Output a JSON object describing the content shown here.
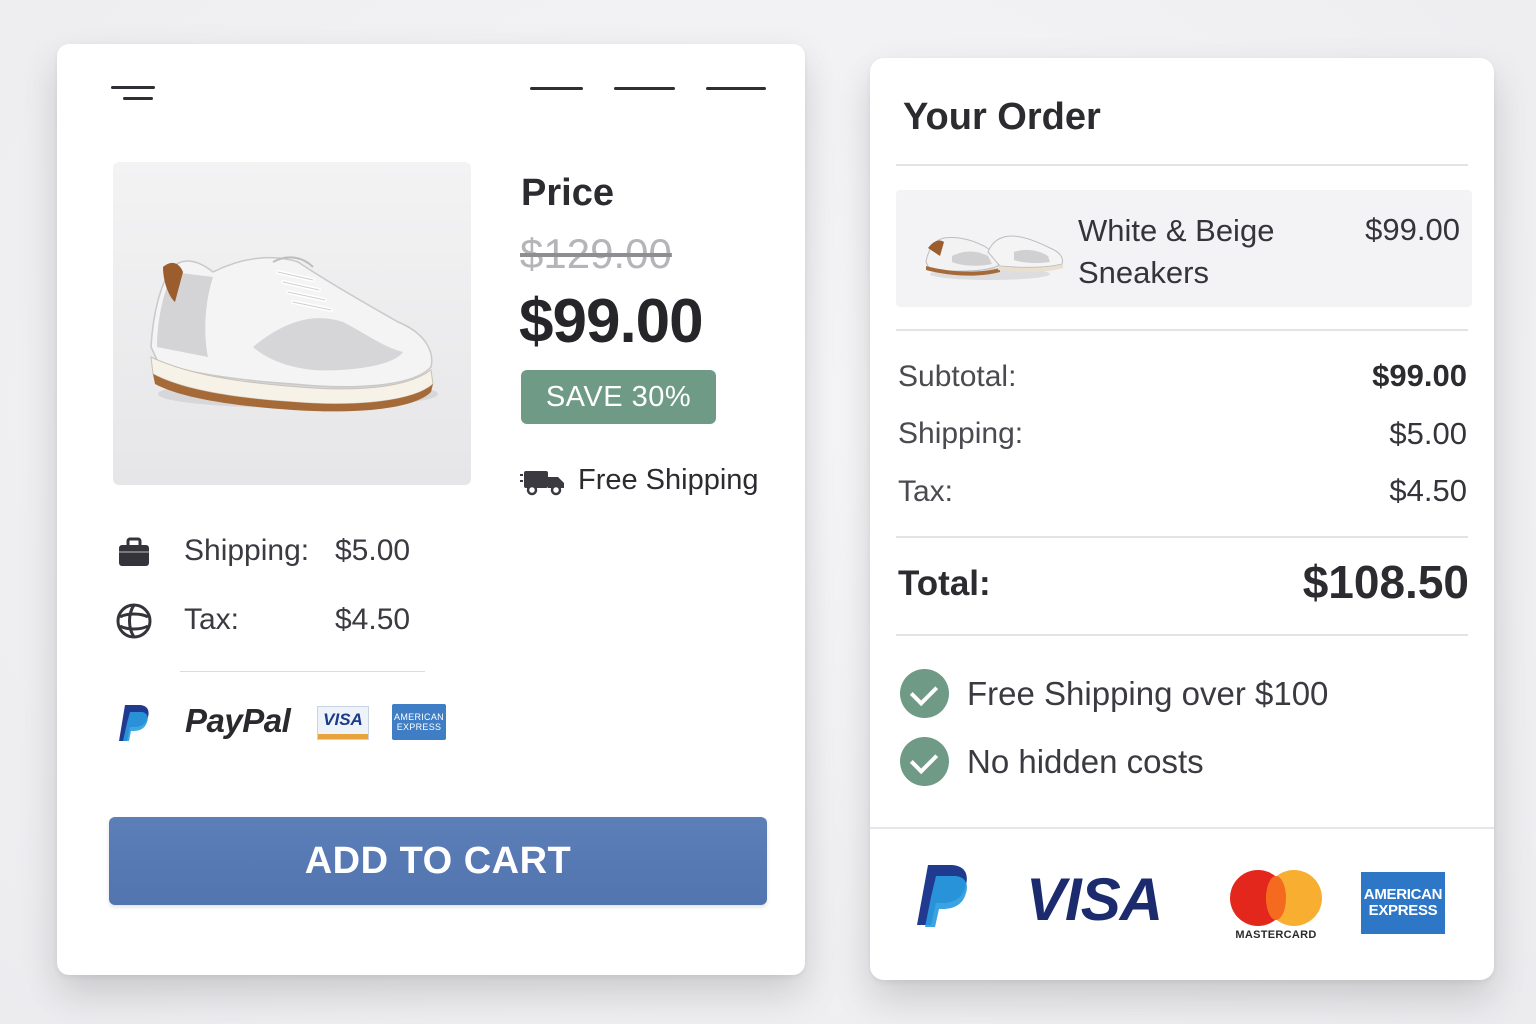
{
  "product": {
    "price_heading": "Price",
    "old_price": "$129.00",
    "new_price": "$99.00",
    "save_badge": "SAVE 30%",
    "free_shipping": "Free Shipping",
    "fees": [
      {
        "label": "Shipping:",
        "value": "$5.00",
        "icon": "briefcase-icon"
      },
      {
        "label": "Tax:",
        "value": "$4.50",
        "icon": "globe-icon"
      }
    ],
    "payment_methods": {
      "paypal_wordmark": "PayPal",
      "visa": "VISA",
      "amex": "AMERICAN EXPRESS"
    },
    "add_to_cart": "ADD TO CART"
  },
  "order": {
    "title": "Your Order",
    "item": {
      "name": "White & Beige Sneakers",
      "price": "$99.00"
    },
    "summary": {
      "subtotal_label": "Subtotal:",
      "subtotal_value": "$99.00",
      "shipping_label": "Shipping:",
      "shipping_value": "$5.00",
      "tax_label": "Tax:",
      "tax_value": "$4.50"
    },
    "total_label": "Total:",
    "total_value": "$108.50",
    "features": [
      "Free Shipping over $100",
      "No hidden costs"
    ],
    "payment_logos": {
      "visa": "VISA",
      "mastercard": "MASTERCARD",
      "amex_line1": "AMERICAN",
      "amex_line2": "EXPRESS"
    }
  },
  "colors": {
    "accent_green": "#6e9a86",
    "button_blue": "#5274af",
    "text_dark": "#2b2b30"
  }
}
